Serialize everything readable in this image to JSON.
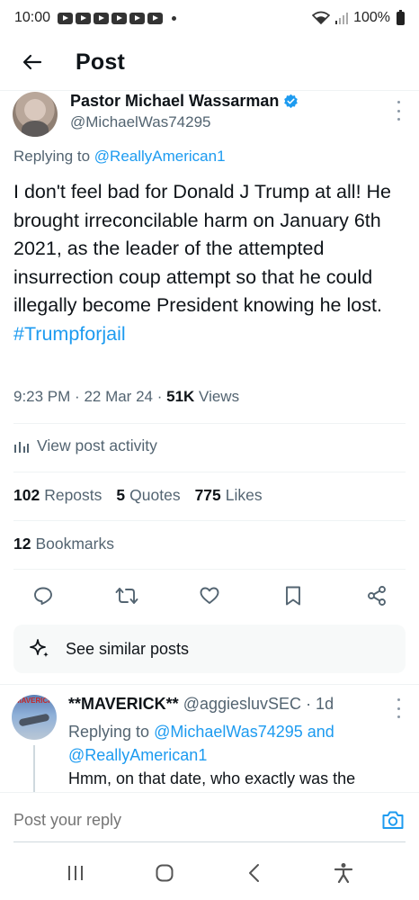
{
  "status_bar": {
    "time": "10:00",
    "battery": "100%"
  },
  "header": {
    "title": "Post"
  },
  "author": {
    "name": "Pastor Michael Wassarman",
    "handle": "@MichaelWas74295"
  },
  "replying": {
    "prefix": "Replying to",
    "handle": "@ReallyAmerican1"
  },
  "post": {
    "text": "I don't feel bad for Donald J Trump at all! He brought irreconcilable harm on January 6th 2021, as the leader of the attempted insurrection coup attempt so that he could illegally become President knowing he lost.",
    "hashtag": "#Trumpforjail"
  },
  "meta": {
    "time": "9:23 PM",
    "date": "22 Mar 24",
    "views_count": "51K",
    "views_label": "Views"
  },
  "activity": {
    "label": "View post activity"
  },
  "stats": {
    "reposts_count": "102",
    "reposts_label": "Reposts",
    "quotes_count": "5",
    "quotes_label": "Quotes",
    "likes_count": "775",
    "likes_label": "Likes",
    "bookmarks_count": "12",
    "bookmarks_label": "Bookmarks"
  },
  "actions": [
    "reply-icon",
    "repost-icon",
    "like-icon",
    "bookmark-icon",
    "share-icon"
  ],
  "similar": {
    "label": "See similar posts"
  },
  "reply": {
    "name": "**MAVERICK**",
    "handle": "@aggiesluvSEC",
    "time": "· 1d",
    "replying_prefix": "Replying to",
    "replying_handle1": "@MichaelWas74295",
    "replying_and": "and",
    "replying_handle2": "@ReallyAmerican1",
    "text": "Hmm, on that date, who exactly was the",
    "avatar_text": "MAVERICK"
  },
  "reply_bar": {
    "placeholder": "Post your reply"
  },
  "colors": {
    "accent": "#1d9bf0",
    "secondary_text": "#536471",
    "primary_text": "#0f1419"
  }
}
